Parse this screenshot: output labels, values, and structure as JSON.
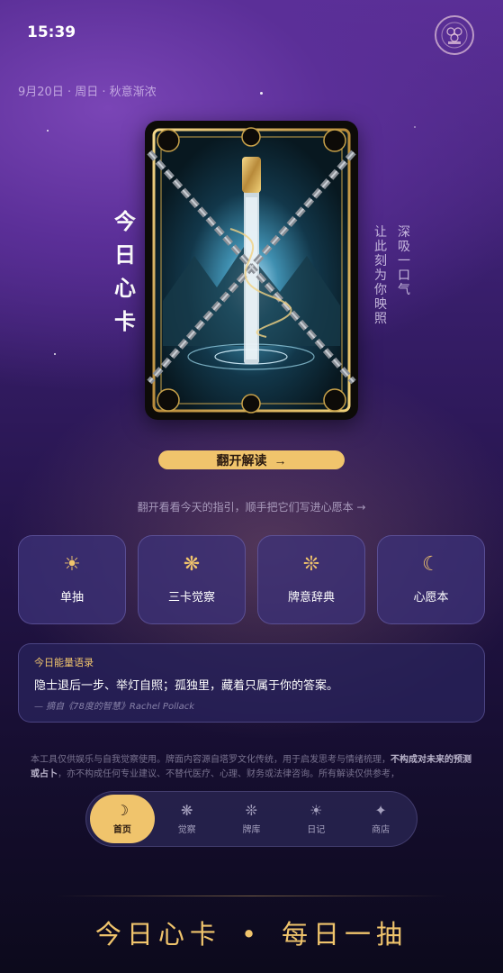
{
  "status_bar": {
    "time": "15:39"
  },
  "header": {
    "date": "9月20日 · 周日 · 秋意渐浓"
  },
  "hero": {
    "title_chars": [
      "今",
      "日",
      "心",
      "卡"
    ],
    "side_text_1": [
      "深",
      "吸",
      "一",
      "口",
      "气"
    ],
    "side_text_2": [
      "让",
      "此",
      "刻",
      "为",
      "你",
      "映",
      "照"
    ],
    "card_image": "tarot-card-chained-sword"
  },
  "flip_button": {
    "label": "翻开解读",
    "arrow": "→"
  },
  "hint": "翻开看看今天的指引，顺手把它们写进心愿本 →",
  "tiles": [
    {
      "icon": "sun-icon",
      "glyph": "☀",
      "label": "单抽"
    },
    {
      "icon": "flower-icon",
      "glyph": "❋",
      "label": "三卡觉察"
    },
    {
      "icon": "snowflake-icon",
      "glyph": "❊",
      "label": "牌意辞典"
    },
    {
      "icon": "moon-icon",
      "glyph": "☾",
      "label": "心愿本"
    }
  ],
  "quote": {
    "title": "今日能量语录",
    "text": "隐士退后一步、举灯自照；孤独里，藏着只属于你的答案。",
    "source": "— 摘自《78度的智慧》Rachel Pollack"
  },
  "disclaimer": {
    "part1": "本工具仅供娱乐与自我觉察使用。牌面内容源自塔罗文化传统，用于启发思考与情绪梳理，",
    "bold": "不构成对未来的预测或占卜",
    "part2": "，亦不构成任何专业建议、不替代医疗、心理、财务或法律咨询。所有解读仅供参考，"
  },
  "nav": [
    {
      "glyph": "☽",
      "label": "首页",
      "active": true
    },
    {
      "glyph": "❋",
      "label": "觉察",
      "active": false
    },
    {
      "glyph": "❊",
      "label": "牌库",
      "active": false
    },
    {
      "glyph": "☀",
      "label": "日记",
      "active": false
    },
    {
      "glyph": "✦",
      "label": "商店",
      "active": false
    }
  ],
  "footer": {
    "left": "今日心卡",
    "dot": "•",
    "right": "每日一抽"
  },
  "colors": {
    "accent": "#f0c46c",
    "tile_bg": "#3c3278",
    "bg_top": "#5a2f96",
    "bg_bottom": "#0c0a1c"
  }
}
